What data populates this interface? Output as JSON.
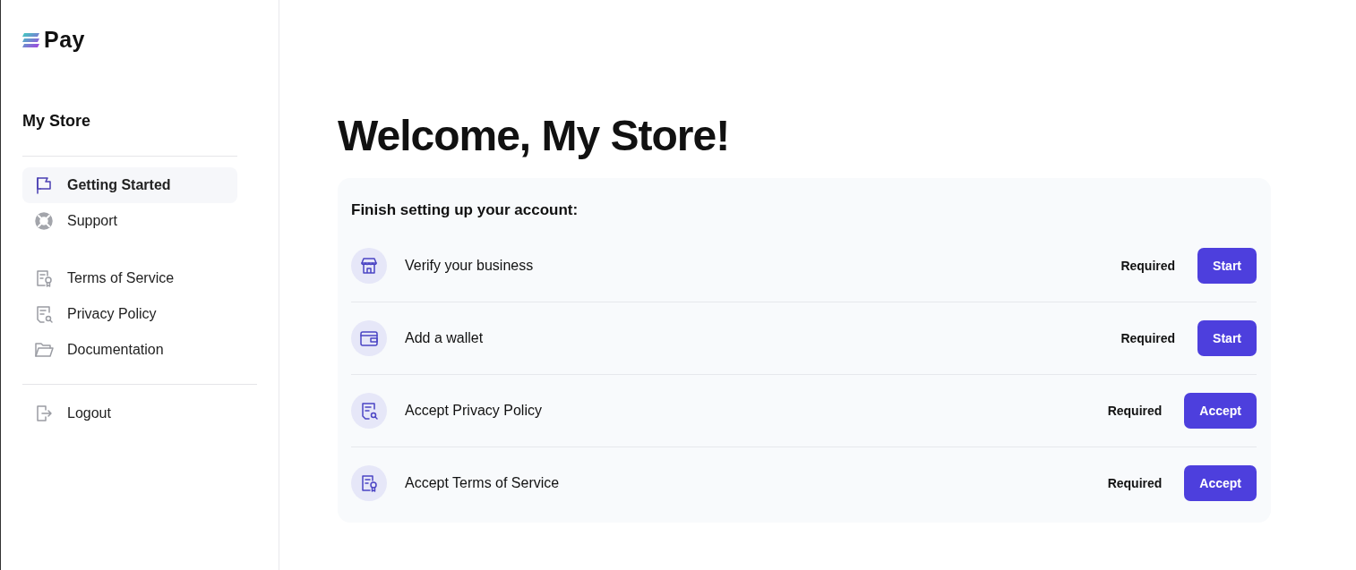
{
  "logo": {
    "text": "Pay"
  },
  "store_name": "My Store",
  "sidebar": {
    "groups": [
      [
        {
          "label": "Getting Started",
          "kind": "flag",
          "selected": true
        },
        {
          "label": "Support",
          "kind": "lifebuoy",
          "selected": false
        }
      ],
      [
        {
          "label": "Terms of Service",
          "kind": "doc-award",
          "selected": false
        },
        {
          "label": "Privacy Policy",
          "kind": "doc-search",
          "selected": false
        },
        {
          "label": "Documentation",
          "kind": "folder",
          "selected": false
        }
      ],
      [
        {
          "label": "Logout",
          "kind": "logout",
          "selected": false
        }
      ]
    ]
  },
  "heading": "Welcome, My Store!",
  "setup": {
    "title": "Finish setting up your account:",
    "tasks": [
      {
        "label": "Verify your business",
        "kind": "store",
        "status": "Required",
        "action": "Start"
      },
      {
        "label": "Add a wallet",
        "kind": "wallet",
        "status": "Required",
        "action": "Start"
      },
      {
        "label": "Accept Privacy Policy",
        "kind": "doc-search",
        "status": "Required",
        "action": "Accept"
      },
      {
        "label": "Accept Terms of Service",
        "kind": "doc-award",
        "status": "Required",
        "action": "Accept"
      }
    ]
  }
}
